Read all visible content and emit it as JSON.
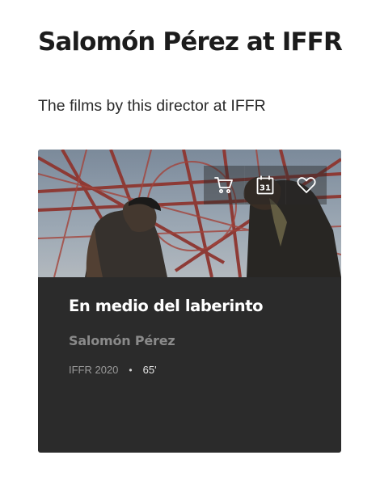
{
  "page": {
    "title": "Salomón Pérez at IFFR",
    "intro": "The films by this director at IFFR"
  },
  "film": {
    "title": "En medio del laberinto",
    "director": "Salomón Pérez",
    "edition": "IFFR 2020",
    "duration": "65'",
    "actions": [
      {
        "name": "cart",
        "icon": "shopping-cart-icon"
      },
      {
        "name": "calendar",
        "icon": "calendar-icon",
        "label": "31"
      },
      {
        "name": "favorite",
        "icon": "heart-icon"
      }
    ]
  },
  "colors": {
    "card_background": "#2b2b2b",
    "title_text": "#1c1c1c",
    "card_title_text": "#ffffff",
    "director_text": "#8a8a8a",
    "meta_text": "#9a9a9a"
  }
}
